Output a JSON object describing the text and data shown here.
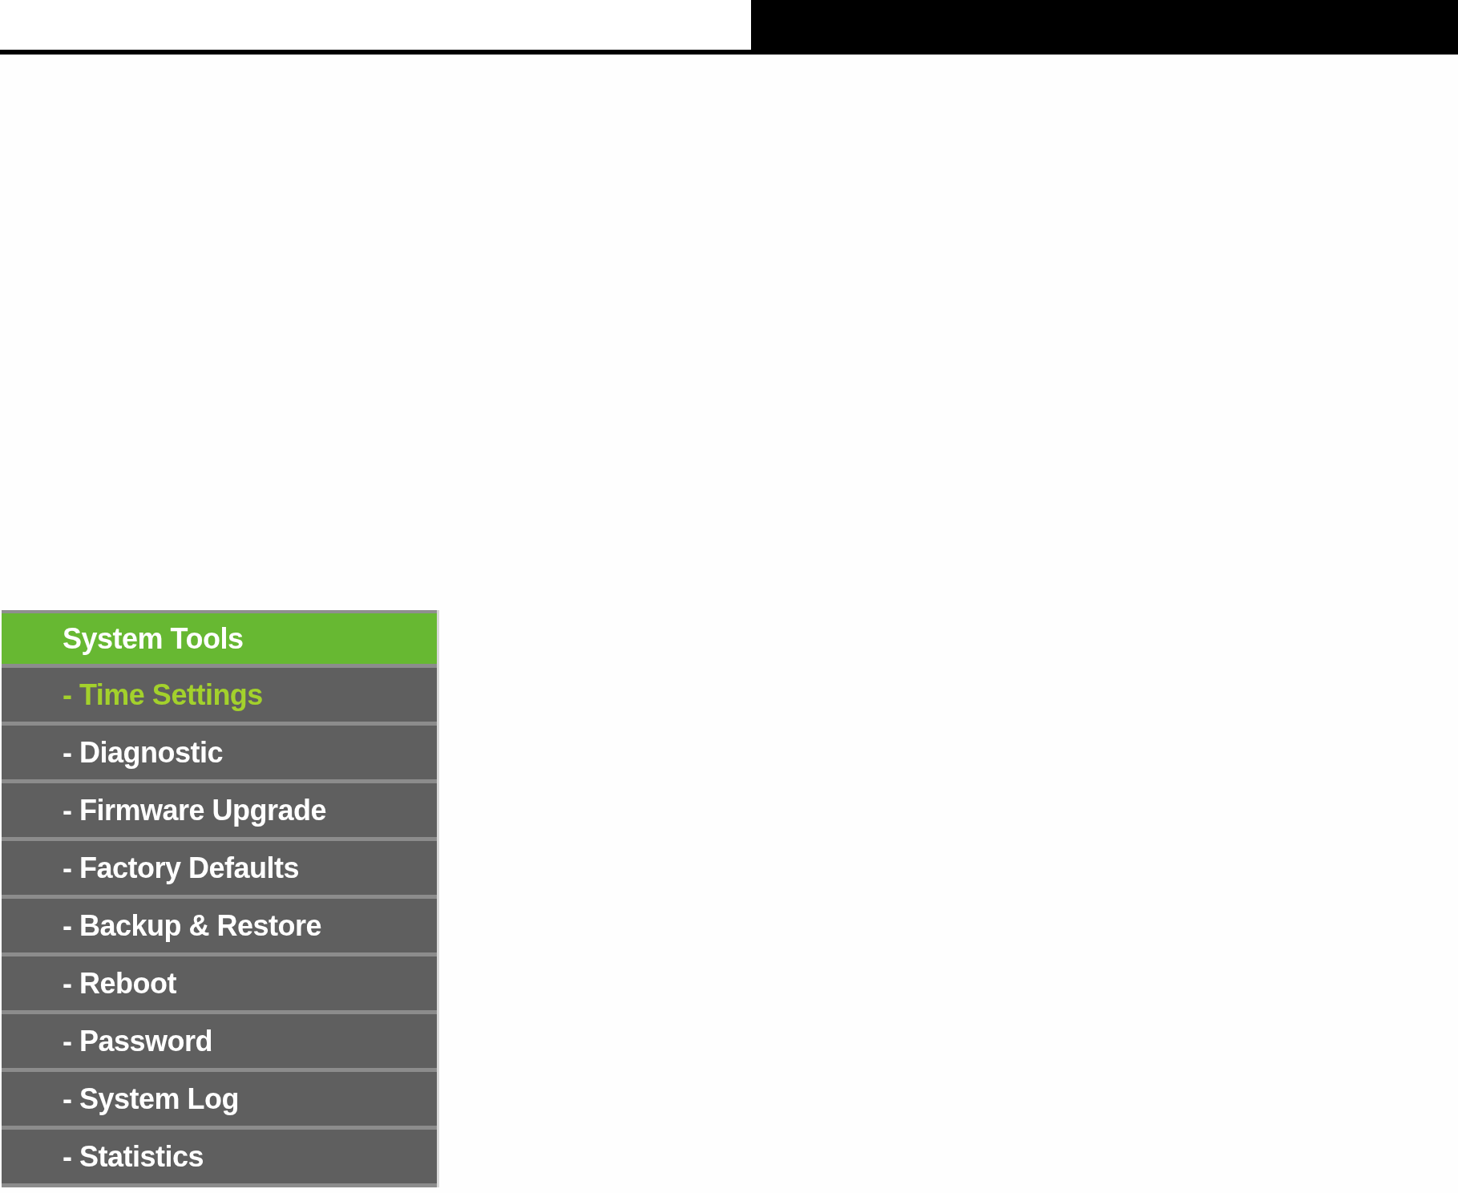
{
  "menu": {
    "section": {
      "label": "System Tools"
    },
    "items": [
      {
        "label": "- Time Settings",
        "selected": true
      },
      {
        "label": "- Diagnostic",
        "selected": false
      },
      {
        "label": "- Firmware Upgrade",
        "selected": false
      },
      {
        "label": "- Factory Defaults",
        "selected": false
      },
      {
        "label": "- Backup & Restore",
        "selected": false
      },
      {
        "label": "- Reboot",
        "selected": false
      },
      {
        "label": "- Password",
        "selected": false
      },
      {
        "label": "- System Log",
        "selected": false
      },
      {
        "label": "- Statistics",
        "selected": false
      }
    ]
  }
}
